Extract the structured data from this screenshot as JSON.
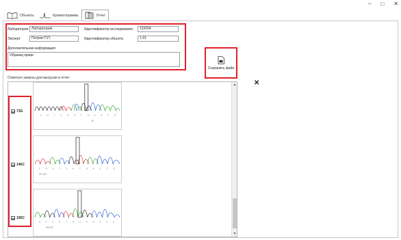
{
  "window": {
    "minimize": "–",
    "maximize": "□",
    "close": "✕"
  },
  "tabs": [
    {
      "label": "Объекты",
      "icon": "book-icon",
      "active": false
    },
    {
      "label": "Хроматограммы",
      "icon": "chromatogram-icon",
      "active": false
    },
    {
      "label": "Отчет",
      "icon": "report-icon",
      "active": true
    }
  ],
  "form": {
    "lab_label": "Лаборатория",
    "lab_value": "Лаборатория",
    "expert_label": "Эксперт",
    "expert_value": "Петров П.П.",
    "study_id_label": "Идентификатор исследования",
    "study_id_value": "123254",
    "object_id_label": "Идентификатор объекта",
    "object_id_value": "1-01",
    "extra_label": "Дополнительная информация",
    "extra_value": "Образец крови"
  },
  "save": {
    "label": "Сохранить файл"
  },
  "list": {
    "title": "Отметьте замены для выгрузки в отчет",
    "items": [
      {
        "label": "73G",
        "checked": true,
        "ticks": "60"
      },
      {
        "label": "146C",
        "checked": true,
        "ticks": "141   150"
      },
      {
        "label": "195C",
        "checked": true,
        "ticks": "190   200"
      }
    ]
  },
  "colors": {
    "highlight": "#e0202a",
    "base_a": "#2aa02a",
    "base_c": "#2a5ad8",
    "base_g": "#222222",
    "base_t": "#d82a2a"
  }
}
